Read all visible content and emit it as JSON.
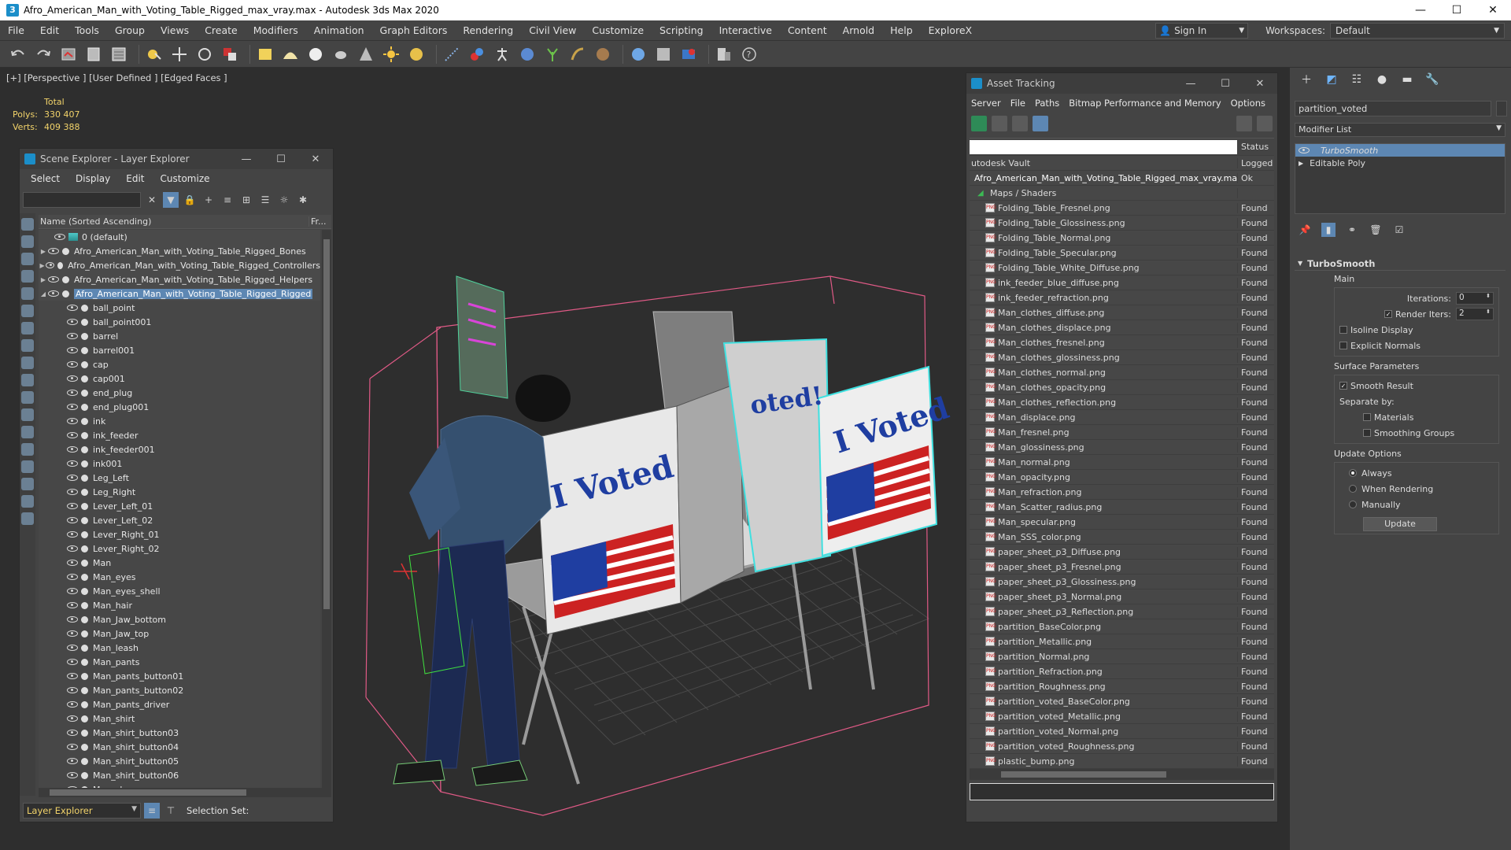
{
  "window": {
    "title": "Afro_American_Man_with_Voting_Table_Rigged_max_vray.max - Autodesk 3ds Max 2020",
    "minimize": "—",
    "maximize": "☐",
    "close": "✕"
  },
  "menubar": {
    "items": [
      "File",
      "Edit",
      "Tools",
      "Group",
      "Views",
      "Create",
      "Modifiers",
      "Animation",
      "Graph Editors",
      "Rendering",
      "Civil View",
      "Customize",
      "Scripting",
      "Interactive",
      "Content",
      "Arnold",
      "Help",
      "ExploreX"
    ],
    "sign_in": "Sign In",
    "workspaces_label": "Workspaces:",
    "workspaces_value": "Default"
  },
  "viewport": {
    "label": "[+] [Perspective ] [User Defined ] [Edged Faces ]",
    "stats": {
      "total_label": "Total",
      "polys_label": "Polys:",
      "polys_value": "330 407",
      "verts_label": "Verts:",
      "verts_value": "409 388"
    },
    "booth_text": "I Voted",
    "booth_text_partial": "oted!"
  },
  "scene_explorer": {
    "title": "Scene Explorer - Layer Explorer",
    "menu": [
      "Select",
      "Display",
      "Edit",
      "Customize"
    ],
    "col_name": "Name (Sorted Ascending)",
    "col_fr": "Fr...",
    "layers": [
      {
        "name": "0 (default)",
        "expander": ""
      },
      {
        "name": "Afro_American_Man_with_Voting_Table_Rigged_Bones",
        "expander": "▶"
      },
      {
        "name": "Afro_American_Man_with_Voting_Table_Rigged_Controllers",
        "expander": "▶"
      },
      {
        "name": "Afro_American_Man_with_Voting_Table_Rigged_Helpers",
        "expander": "▶"
      },
      {
        "name": "Afro_American_Man_with_Voting_Table_Rigged_Rigged",
        "expander": "◢"
      }
    ],
    "objects": [
      "ball_point",
      "ball_point001",
      "barrel",
      "barrel001",
      "cap",
      "cap001",
      "end_plug",
      "end_plug001",
      "ink",
      "ink_feeder",
      "ink_feeder001",
      "ink001",
      "Leg_Left",
      "Leg_Right",
      "Lever_Left_01",
      "Lever_Left_02",
      "Lever_Right_01",
      "Lever_Right_02",
      "Man",
      "Man_eyes",
      "Man_eyes_shell",
      "Man_hair",
      "Man_Jaw_bottom",
      "Man_Jaw_top",
      "Man_leash",
      "Man_pants",
      "Man_pants_button01",
      "Man_pants_button02",
      "Man_pants_driver",
      "Man_shirt",
      "Man_shirt_button03",
      "Man_shirt_button04",
      "Man_shirt_button05",
      "Man_shirt_button06",
      "Man_shoes"
    ],
    "bottom_dropdown": "Layer Explorer",
    "selection_set": "Selection Set:"
  },
  "asset_tracking": {
    "title": "Asset Tracking",
    "menu": [
      "Server",
      "File",
      "Paths",
      "Bitmap Performance and Memory",
      "Options"
    ],
    "col_status": "Status",
    "vault_row": {
      "name": "utodesk Vault",
      "status": "Logged"
    },
    "scene_row": {
      "name": "Afro_American_Man_with_Voting_Table_Rigged_max_vray.max",
      "status": "Ok"
    },
    "maps_row": "Maps / Shaders",
    "files": [
      "Folding_Table_Fresnel.png",
      "Folding_Table_Glossiness.png",
      "Folding_Table_Normal.png",
      "Folding_Table_Specular.png",
      "Folding_Table_White_Diffuse.png",
      "ink_feeder_blue_diffuse.png",
      "ink_feeder_refraction.png",
      "Man_clothes_diffuse.png",
      "Man_clothes_displace.png",
      "Man_clothes_fresnel.png",
      "Man_clothes_glossiness.png",
      "Man_clothes_normal.png",
      "Man_clothes_opacity.png",
      "Man_clothes_reflection.png",
      "Man_displace.png",
      "Man_fresnel.png",
      "Man_glossiness.png",
      "Man_normal.png",
      "Man_opacity.png",
      "Man_refraction.png",
      "Man_Scatter_radius.png",
      "Man_specular.png",
      "Man_SSS_color.png",
      "paper_sheet_p3_Diffuse.png",
      "paper_sheet_p3_Fresnel.png",
      "paper_sheet_p3_Glossiness.png",
      "paper_sheet_p3_Normal.png",
      "paper_sheet_p3_Reflection.png",
      "partition_BaseColor.png",
      "partition_Metallic.png",
      "partition_Normal.png",
      "partition_Refraction.png",
      "partition_Roughness.png",
      "partition_voted_BaseColor.png",
      "partition_voted_Metallic.png",
      "partition_voted_Normal.png",
      "partition_voted_Roughness.png",
      "plastic_bump.png"
    ],
    "file_status": "Found"
  },
  "command_panel": {
    "object_name": "partition_voted",
    "modifier_list": "Modifier List",
    "stack": [
      "TurboSmooth",
      "Editable Poly"
    ],
    "rollout_title": "TurboSmooth",
    "main_label": "Main",
    "iterations_label": "Iterations:",
    "iterations_value": "0",
    "render_iters_label": "Render Iters:",
    "render_iters_value": "2",
    "isoline_display": "Isoline Display",
    "explicit_normals": "Explicit Normals",
    "surface_params_label": "Surface Parameters",
    "smooth_result": "Smooth Result",
    "separate_by": "Separate by:",
    "materials": "Materials",
    "smoothing_groups": "Smoothing Groups",
    "update_options_label": "Update Options",
    "always": "Always",
    "when_rendering": "When Rendering",
    "manually": "Manually",
    "update_button": "Update"
  }
}
